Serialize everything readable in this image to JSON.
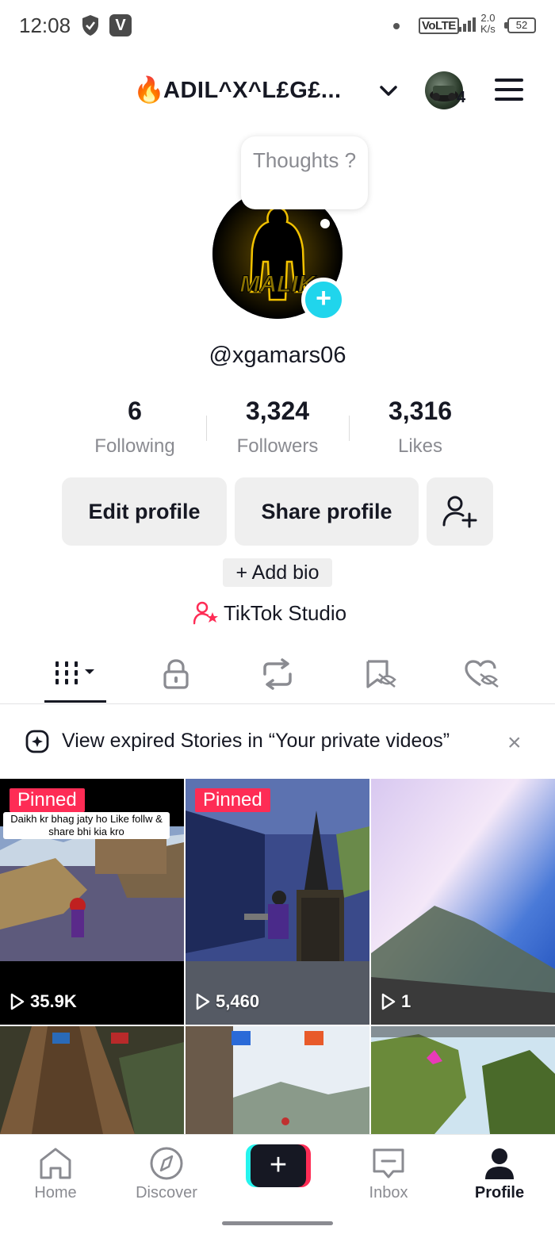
{
  "status_bar": {
    "time": "12:08",
    "volte": "VoLTE",
    "speed_value": "2.0",
    "speed_unit": "K/s",
    "battery": "52",
    "icons": [
      "shield-icon",
      "v-app-icon",
      "signal-icon",
      "battery-icon"
    ]
  },
  "header": {
    "fire_emoji": "🔥",
    "account_name": "ADIL^X^L£G£...",
    "notification_count": "4"
  },
  "profile": {
    "thought_bubble": "Thoughts ?",
    "avatar_text": "MALIK",
    "username": "@xgamars06",
    "stats": [
      {
        "value": "6",
        "label": "Following"
      },
      {
        "value": "3,324",
        "label": "Followers"
      },
      {
        "value": "3,316",
        "label": "Likes"
      }
    ],
    "edit_profile": "Edit profile",
    "share_profile": "Share profile",
    "add_bio": "+ Add bio",
    "tiktok_studio": "TikTok Studio"
  },
  "tabs": [
    "videos-grid-tab",
    "private-tab",
    "reposts-tab",
    "favorites-tab",
    "liked-tab"
  ],
  "banner": {
    "text": "View expired Stories in “Your private videos”",
    "close": "×"
  },
  "videos": [
    {
      "pinned": "Pinned",
      "caption": "Daikh kr bhag jaty ho Like follw & share bhi kia kro",
      "views": "35.9K"
    },
    {
      "pinned": "Pinned",
      "caption": "",
      "views": "5,460"
    },
    {
      "pinned": "",
      "caption": "",
      "views": "1"
    },
    {
      "pinned": "",
      "caption": "",
      "views": ""
    },
    {
      "pinned": "",
      "caption": "",
      "views": ""
    },
    {
      "pinned": "",
      "caption": "",
      "views": ""
    }
  ],
  "bottom_nav": {
    "home": "Home",
    "discover": "Discover",
    "create": "+",
    "inbox": "Inbox",
    "profile": "Profile"
  },
  "colors": {
    "accent_red": "#fe2c55",
    "accent_cyan": "#25f4ee",
    "plus_blue": "#20d5ec",
    "text_primary": "#161823",
    "text_secondary": "#8a8b91"
  }
}
